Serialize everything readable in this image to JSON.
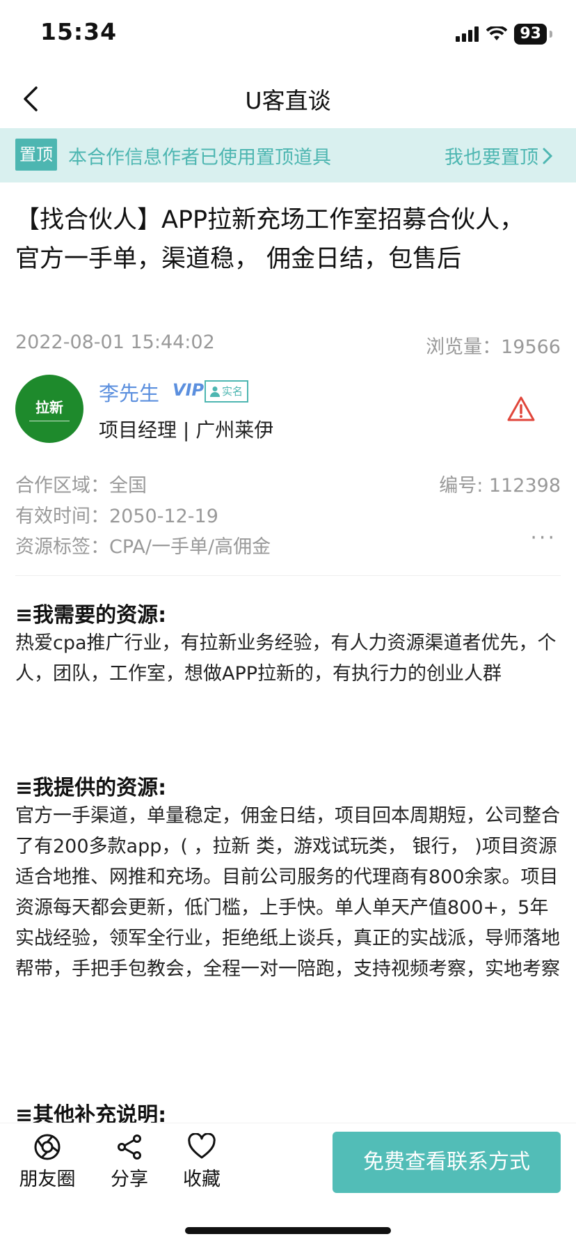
{
  "status": {
    "time": "15:34",
    "battery": "93"
  },
  "nav": {
    "title": "U客直谈"
  },
  "pin_banner": {
    "tag": "置顶",
    "text": "本合作信息作者已使用置顶道具",
    "link": "我也要置顶"
  },
  "post": {
    "title": "【找合伙人】APP拉新充场工作室招募合伙人，官方一手单，渠道稳，            佣金日结，包售后",
    "date": "2022-08-01 15:44:02",
    "views_label": "浏览量：",
    "views_value": "19566"
  },
  "author": {
    "avatar_text": "拉新",
    "name": "李先生",
    "vip": "VIP",
    "verified": "实名",
    "role": "项目经理 | 广州莱伊"
  },
  "info": {
    "region_label": "合作区域：",
    "region_value": "全国",
    "id_label": "编号: ",
    "id_value": "112398",
    "valid_label": "有效时间：",
    "valid_value": "2050-12-19",
    "tags_label": "资源标签：",
    "tags_value": "CPA/一手单/高佣金",
    "more": "···"
  },
  "sections": {
    "need_title": "≡我需要的资源:",
    "need_body": "热爱cpa推广行业，有拉新业务经验，有人力资源渠道者优先，个人，团队，工作室，想做APP拉新的，有执行力的创业人群",
    "offer_title": "≡我提供的资源:",
    "offer_body": "官方一手渠道，单量稳定，佣金日结，项目回本周期短，公司整合了有200多款app，(             ，拉新      类，游戏试玩类，          银行，          )项目资源适合地推、网推和充场。目前公司服务的代理商有800余家。项目资源每天都会更新，低门槛，上手快。单人单天产值800+，5年实战经验，领军全行业，拒绝纸上谈兵，真正的实战派，导师落地帮带，手把手包教会，全程一对一陪跑，支持视频考察，实地考察",
    "other_title": "≡其他补充说明:"
  },
  "bottom": {
    "moments": "朋友圈",
    "share": "分享",
    "favorite": "收藏",
    "contact": "免费查看联系方式"
  }
}
